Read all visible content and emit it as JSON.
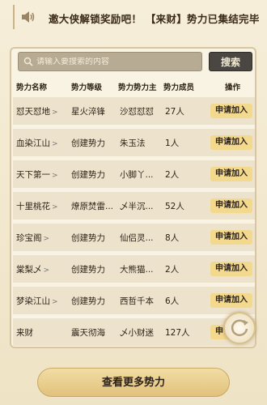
{
  "notice": {
    "text": "邀大侠解锁奖励吧！  【来财】势力已集结完毕，"
  },
  "search": {
    "placeholder": "请输入要搜索的内容",
    "button_label": "搜索"
  },
  "table": {
    "headers": [
      "势力名称",
      "势力等级",
      "势力势力主",
      "势力成员",
      "操作"
    ],
    "rows": [
      {
        "name": "怼天怼地",
        "level": "星火淬锋",
        "leader": "沙怼怼怼",
        "members": "27人",
        "action": "申请加入"
      },
      {
        "name": "血染江山",
        "level": "创建势力",
        "leader": "朱玉法",
        "members": "1人",
        "action": "申请加入"
      },
      {
        "name": "天下第一",
        "level": "创建势力",
        "leader": "小脚丫...",
        "members": "2人",
        "action": "申请加入"
      },
      {
        "name": "十里桃花",
        "level": "燎原焚雷...",
        "leader": "乄半沉...",
        "members": "52人",
        "action": "申请加入"
      },
      {
        "name": "珍宝阁",
        "level": "创建势力",
        "leader": "仙侣灵...",
        "members": "8人",
        "action": "申请加入"
      },
      {
        "name": "棠梨乄",
        "level": "创建势力",
        "leader": "大熊猫...",
        "members": "2人",
        "action": "申请加入"
      },
      {
        "name": "梦染江山",
        "level": "创建势力",
        "leader": "西哲千本",
        "members": "6人",
        "action": "申请加入"
      },
      {
        "name": "来财",
        "level": "震天彻海",
        "leader": "乄小财迷",
        "members": "127人",
        "action": "申请加入"
      }
    ]
  },
  "more_button_label": "查看更多势力",
  "icons": {
    "speaker": "speaker-icon",
    "search": "search-icon",
    "chevron": "chevron-right-icon",
    "refresh": "refresh-icon"
  },
  "colors": {
    "background": "#f4ebd4",
    "row_bg": "#ede3cd",
    "apply_button": "#f3d98e",
    "search_button": "#4a4641"
  }
}
